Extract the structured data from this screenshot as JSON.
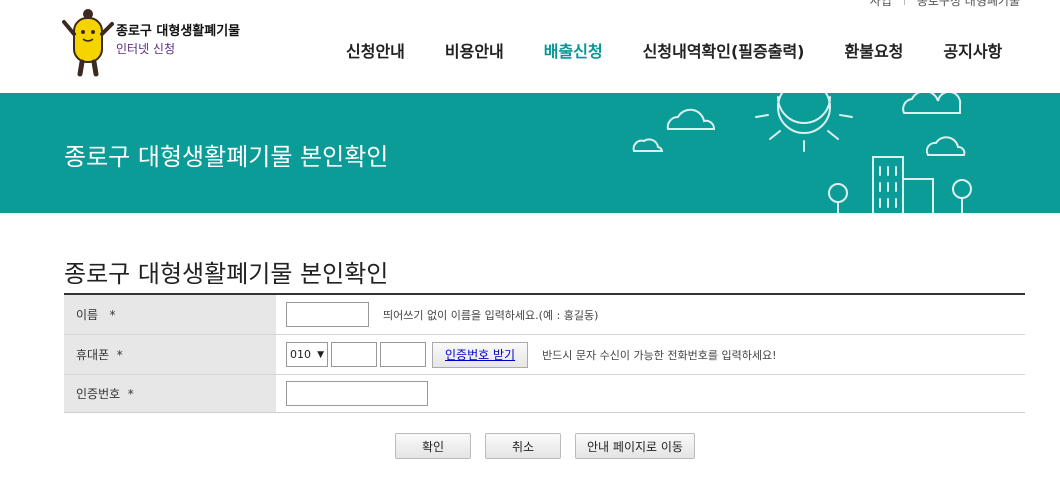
{
  "header": {
    "logo_line1": "종로구 대형생활폐기물",
    "logo_line2": "인터넷 신청",
    "nav": [
      {
        "label": "신청안내"
      },
      {
        "label": "비용안내"
      },
      {
        "label": "배출신청"
      },
      {
        "label": "신청내역확인(필증출력)"
      },
      {
        "label": "환불요청"
      },
      {
        "label": "공지사항"
      }
    ],
    "active_color": "#0a9696"
  },
  "banner": {
    "title": "종로구 대형생활폐기물 본인확인",
    "bg_color": "#0b9c98"
  },
  "section": {
    "title": "종로구 대형생활폐기물 본인확인"
  },
  "form": {
    "name_label": "이름   *",
    "name_hint": "띄어쓰기 없이 이름을 입력하세요.(예 : 홍길동)",
    "phone_label": "휴대폰  *",
    "phone_prefix": "010",
    "cert_button": "인증번호 받기",
    "phone_hint": "반드시 문자 수신이 가능한 전화번호를 입력하세요!",
    "code_label": "인증번호  *"
  },
  "actions": {
    "confirm": "확인",
    "cancel": "취소",
    "guide": "안내 페이지로 이동"
  }
}
